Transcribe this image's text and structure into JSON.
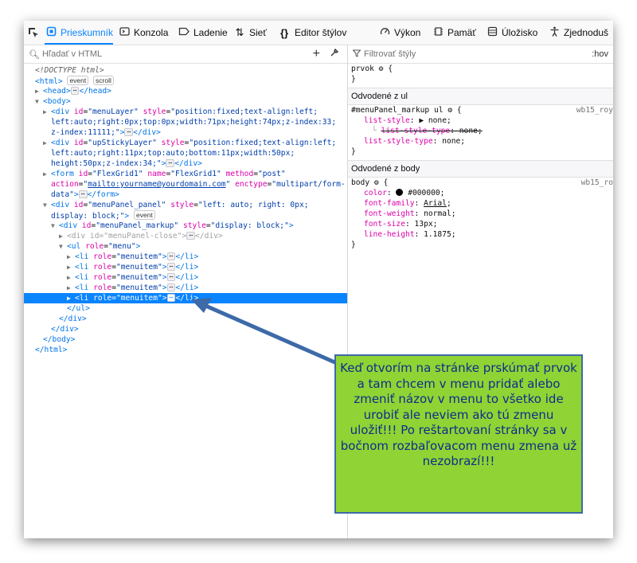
{
  "toolbar": {
    "tabs": [
      {
        "label": "Prieskumník",
        "icon": "inspector-icon"
      },
      {
        "label": "Konzola",
        "icon": "console-icon"
      },
      {
        "label": "Ladenie",
        "icon": "debugger-icon"
      },
      {
        "label": "Sieť",
        "icon": "network-icon"
      },
      {
        "label": "Editor štýlov",
        "icon": "style-editor-icon"
      },
      {
        "label": "Výkon",
        "icon": "performance-icon"
      },
      {
        "label": "Pamäť",
        "icon": "memory-icon"
      },
      {
        "label": "Úložisko",
        "icon": "storage-icon"
      },
      {
        "label": "Zjednoduš",
        "icon": "accessibility-icon"
      }
    ]
  },
  "markup": {
    "search_placeholder": "Hľadať v HTML",
    "lines": {
      "doctype": "<!DOCTYPE html>",
      "badge_event": "event",
      "badge_scroll": "scroll",
      "ellipsis": "⋯",
      "menuLayer_style1": "position:fixed;text-align:left;",
      "menuLayer_style2": "left:auto;right:0px;top:0px;width:71px;height:74px;z-index:33;",
      "menuLayer_style3": "z-index:11111;",
      "upSticky_style1": "position:fixed;text-align:left;",
      "upSticky_style2": "left:auto;right:11px;top:auto;bottom:11px;width:50px;",
      "upSticky_style3": "height:50px;z-index:34;",
      "form_action": "mailto:yourname@yourdomain.com",
      "form_enctype1": "multipart/form-",
      "form_enctype2": "data"
    }
  },
  "rules": {
    "filter_placeholder": "Filtrovať štýly",
    "hov": ":hov",
    "element_selector": "prvok",
    "inherited_ul": "Odvodené z ul",
    "ul_selector": "#menuPanel_markup ul",
    "ul_source": "wb15_roy",
    "inherited_body": "Odvodené z body",
    "body_selector": "body",
    "body_source": "wb15_ro",
    "props_ul": [
      {
        "name": "list-style",
        "value": "▶ none;"
      },
      {
        "name": "list-style-type",
        "value": "none;"
      },
      {
        "name": "list-style-type",
        "value": "none;"
      }
    ],
    "props_body": [
      {
        "name": "color",
        "value": "#000000;"
      },
      {
        "name": "font-family",
        "value": "Arial"
      },
      {
        "name": "font-weight",
        "value": "normal;"
      },
      {
        "name": "font-size",
        "value": "13px;"
      },
      {
        "name": "line-height",
        "value": "1.1875;"
      }
    ]
  },
  "callout": {
    "text": "Keď otvorím na stránke prskúmať prvok a tam chcem v menu pridať alebo zmeniť názov v menu to všetko ide urobiť ale neviem ako tú zmenu uložiť!!! Po reštartovaní stránky sa v bočnom rozbaľovacom menu zmena už nezobrazí!!!",
    "bg_color": "#8fd434",
    "text_color": "#0e2d8c"
  }
}
